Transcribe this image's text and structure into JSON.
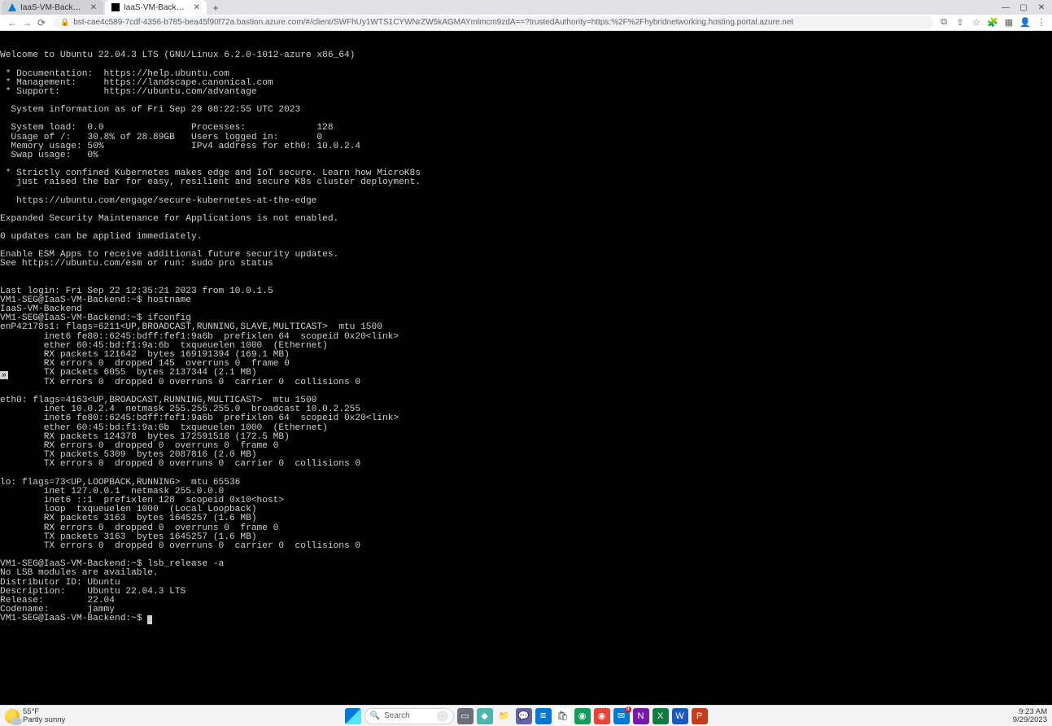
{
  "window": {
    "min": "—",
    "max": "▢",
    "close": "✕"
  },
  "tabs": [
    {
      "title": "IaaS-VM-Backend - Microsoft A",
      "active": false
    },
    {
      "title": "IaaS-VM-Backend",
      "active": true
    }
  ],
  "newtab": "+",
  "addrbar": {
    "back": "←",
    "forward": "→",
    "reload": "⟳",
    "lock": "🔒",
    "url": "bst-cae4c589-7cdf-4356-b785-bea45f90f72a.bastion.azure.com/#/client/SWFhUy1WTS1CYWNrZW5kAGMAYmlmcm9zdA==?trustedAuthority=https:%2F%2Fhybridnetworking.hosting.portal.azure.net",
    "ext": [
      "⧉",
      "⇪",
      "☆",
      "🧩",
      "▦",
      "👤",
      "⋮"
    ]
  },
  "terminal": {
    "lines": [
      "Welcome to Ubuntu 22.04.3 LTS (GNU/Linux 6.2.0-1012-azure x86_64)",
      "",
      " * Documentation:  https://help.ubuntu.com",
      " * Management:     https://landscape.canonical.com",
      " * Support:        https://ubuntu.com/advantage",
      "",
      "  System information as of Fri Sep 29 08:22:55 UTC 2023",
      "",
      "  System load:  0.0                Processes:             128",
      "  Usage of /:   30.8% of 28.89GB   Users logged in:       0",
      "  Memory usage: 50%                IPv4 address for eth0: 10.0.2.4",
      "  Swap usage:   0%",
      "",
      " * Strictly confined Kubernetes makes edge and IoT secure. Learn how MicroK8s",
      "   just raised the bar for easy, resilient and secure K8s cluster deployment.",
      "",
      "   https://ubuntu.com/engage/secure-kubernetes-at-the-edge",
      "",
      "Expanded Security Maintenance for Applications is not enabled.",
      "",
      "0 updates can be applied immediately.",
      "",
      "Enable ESM Apps to receive additional future security updates.",
      "See https://ubuntu.com/esm or run: sudo pro status",
      "",
      "",
      "Last login: Fri Sep 22 12:35:21 2023 from 10.0.1.5",
      "VM1-SEG@IaaS-VM-Backend:~$ hostname",
      "IaaS-VM-Backend",
      "VM1-SEG@IaaS-VM-Backend:~$ ifconfig",
      "enP42178s1: flags=6211<UP,BROADCAST,RUNNING,SLAVE,MULTICAST>  mtu 1500",
      "        inet6 fe80::6245:bdff:fef1:9a6b  prefixlen 64  scopeid 0x20<link>",
      "        ether 60:45:bd:f1:9a:6b  txqueuelen 1000  (Ethernet)",
      "        RX packets 121642  bytes 169191394 (169.1 MB)",
      "        RX errors 0  dropped 145  overruns 0  frame 0",
      "        TX packets 6055  bytes 2137344 (2.1 MB)",
      "        TX errors 0  dropped 0 overruns 0  carrier 0  collisions 0",
      "",
      "eth0: flags=4163<UP,BROADCAST,RUNNING,MULTICAST>  mtu 1500",
      "        inet 10.0.2.4  netmask 255.255.255.0  broadcast 10.0.2.255",
      "        inet6 fe80::6245:bdff:fef1:9a6b  prefixlen 64  scopeid 0x20<link>",
      "        ether 60:45:bd:f1:9a:6b  txqueuelen 1000  (Ethernet)",
      "        RX packets 124378  bytes 172591518 (172.5 MB)",
      "        RX errors 0  dropped 0  overruns 0  frame 0",
      "        TX packets 5309  bytes 2087816 (2.0 MB)",
      "        TX errors 0  dropped 0 overruns 0  carrier 0  collisions 0",
      "",
      "lo: flags=73<UP,LOOPBACK,RUNNING>  mtu 65536",
      "        inet 127.0.0.1  netmask 255.0.0.0",
      "        inet6 ::1  prefixlen 128  scopeid 0x10<host>",
      "        loop  txqueuelen 1000  (Local Loopback)",
      "        RX packets 3163  bytes 1645257 (1.6 MB)",
      "        RX errors 0  dropped 0  overruns 0  frame 0",
      "        TX packets 3163  bytes 1645257 (1.6 MB)",
      "        TX errors 0  dropped 0 overruns 0  carrier 0  collisions 0",
      "",
      "VM1-SEG@IaaS-VM-Backend:~$ lsb_release -a",
      "No LSB modules are available.",
      "Distributor ID: Ubuntu",
      "Description:    Ubuntu 22.04.3 LTS",
      "Release:        22.04",
      "Codename:       jammy"
    ],
    "prompt": "VM1-SEG@IaaS-VM-Backend:~$ ",
    "side_indicator": "»"
  },
  "taskbar": {
    "weather_temp": "55°F",
    "weather_desc": "Partly sunny",
    "search_placeholder": "Search",
    "apps": [
      {
        "name": "task-view-icon",
        "glyph": "▭",
        "bg": "#6b6e76"
      },
      {
        "name": "copilot-icon",
        "glyph": "◆",
        "bg": "#4db6ac"
      },
      {
        "name": "explorer-icon",
        "glyph": "📁",
        "bg": "transparent"
      },
      {
        "name": "teams-icon",
        "glyph": "💬",
        "bg": "#6264a7"
      },
      {
        "name": "vscode-icon",
        "glyph": "⧈",
        "bg": "#0078d4"
      },
      {
        "name": "store-icon",
        "glyph": "🛍",
        "bg": "#ffffff"
      },
      {
        "name": "edge-icon",
        "glyph": "◉",
        "bg": "#0f9d58"
      },
      {
        "name": "chrome-icon",
        "glyph": "◉",
        "bg": "#ea4335"
      },
      {
        "name": "outlook-icon",
        "glyph": "✉",
        "bg": "#0078d4",
        "badge": "9"
      },
      {
        "name": "onenote-icon",
        "glyph": "N",
        "bg": "#7719aa"
      },
      {
        "name": "excel-icon",
        "glyph": "X",
        "bg": "#107c41"
      },
      {
        "name": "word-icon",
        "glyph": "W",
        "bg": "#185abd"
      },
      {
        "name": "powerpoint-icon",
        "glyph": "P",
        "bg": "#c43e1c"
      }
    ],
    "time": "9:23 AM",
    "date": "9/29/2023"
  }
}
